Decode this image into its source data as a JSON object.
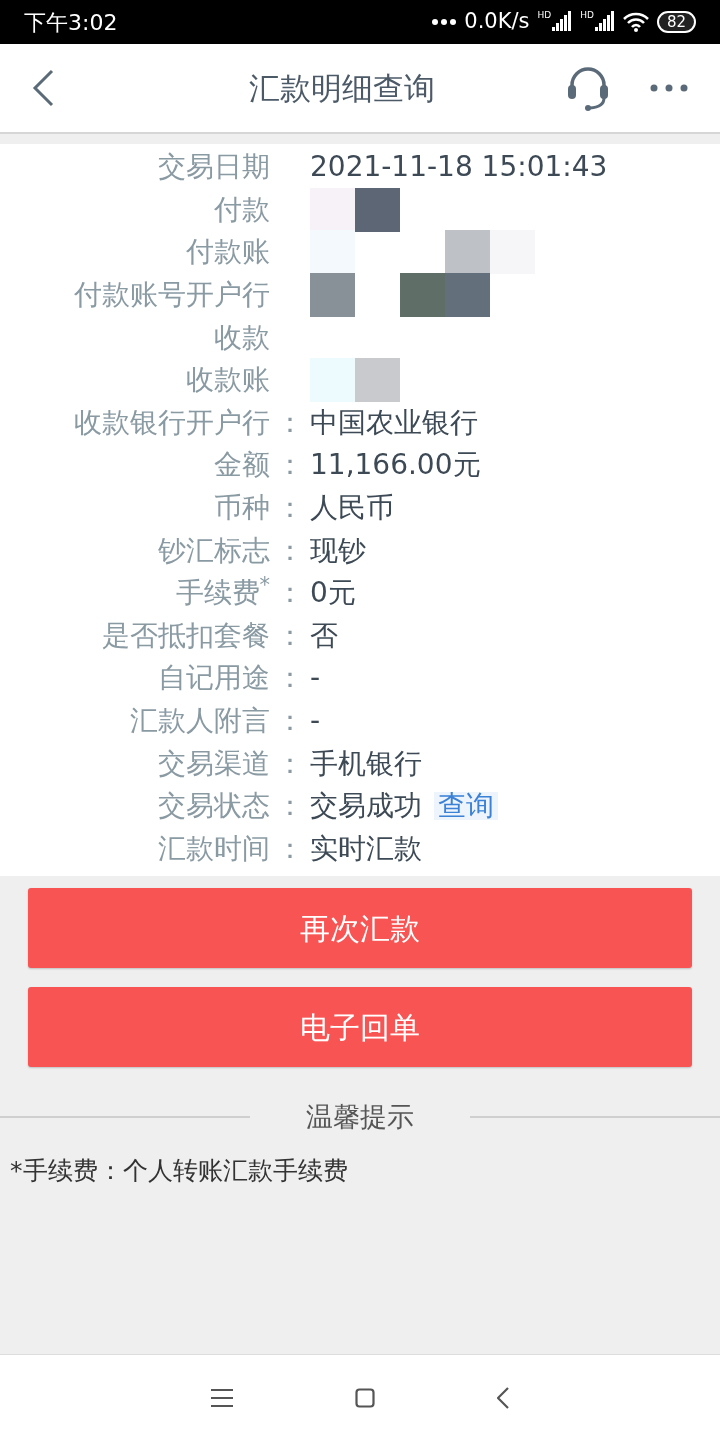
{
  "status_bar": {
    "time": "下午3:02",
    "speed": "0.0K/s",
    "signal_labels": [
      "HD",
      "HD"
    ],
    "battery": "82"
  },
  "header": {
    "title": "汇款明细查询"
  },
  "rows": [
    {
      "kind": "redacted",
      "label": "交易日期",
      "value": "2021-11-18 15:01:43"
    },
    {
      "kind": "redacted",
      "label": "付款"
    },
    {
      "kind": "redacted",
      "label": "付款账"
    },
    {
      "kind": "redacted",
      "label": "付款账号开户行"
    },
    {
      "kind": "redacted",
      "label": "收款"
    },
    {
      "kind": "redacted",
      "label": "收款账"
    },
    {
      "kind": "text",
      "label": "收款银行开户行",
      "colon": "：",
      "value": "中国农业银行"
    },
    {
      "kind": "text",
      "label": "金额",
      "colon": "：",
      "value": "11,166.00元"
    },
    {
      "kind": "text",
      "label": "币种",
      "colon": "：",
      "value": "人民币"
    },
    {
      "kind": "text",
      "label": "钞汇标志",
      "colon": "：",
      "value": "现钞"
    },
    {
      "kind": "text",
      "label": "手续费$^{*}$",
      "colon": "：",
      "value": "0元"
    },
    {
      "kind": "text",
      "label": "是否抵扣套餐",
      "colon": "：",
      "value": "否"
    },
    {
      "kind": "text",
      "label": "自记用途",
      "colon": "：",
      "value": "-"
    },
    {
      "kind": "text",
      "label": "汇款人附言",
      "colon": "：",
      "value": "-"
    },
    {
      "kind": "text",
      "label": "交易渠道",
      "colon": "：",
      "value": "手机银行"
    },
    {
      "kind": "link",
      "label": "交易状态",
      "colon": "：",
      "value": "交易成功",
      "link": "查询"
    },
    {
      "kind": "text",
      "label": "汇款时间",
      "colon": "：",
      "value": "实时汇款"
    }
  ],
  "buttons": [
    "再次汇款",
    "电子回单"
  ],
  "tips": {
    "title": "温馨提示",
    "text": "*手续费：个人转账汇款手续费"
  }
}
